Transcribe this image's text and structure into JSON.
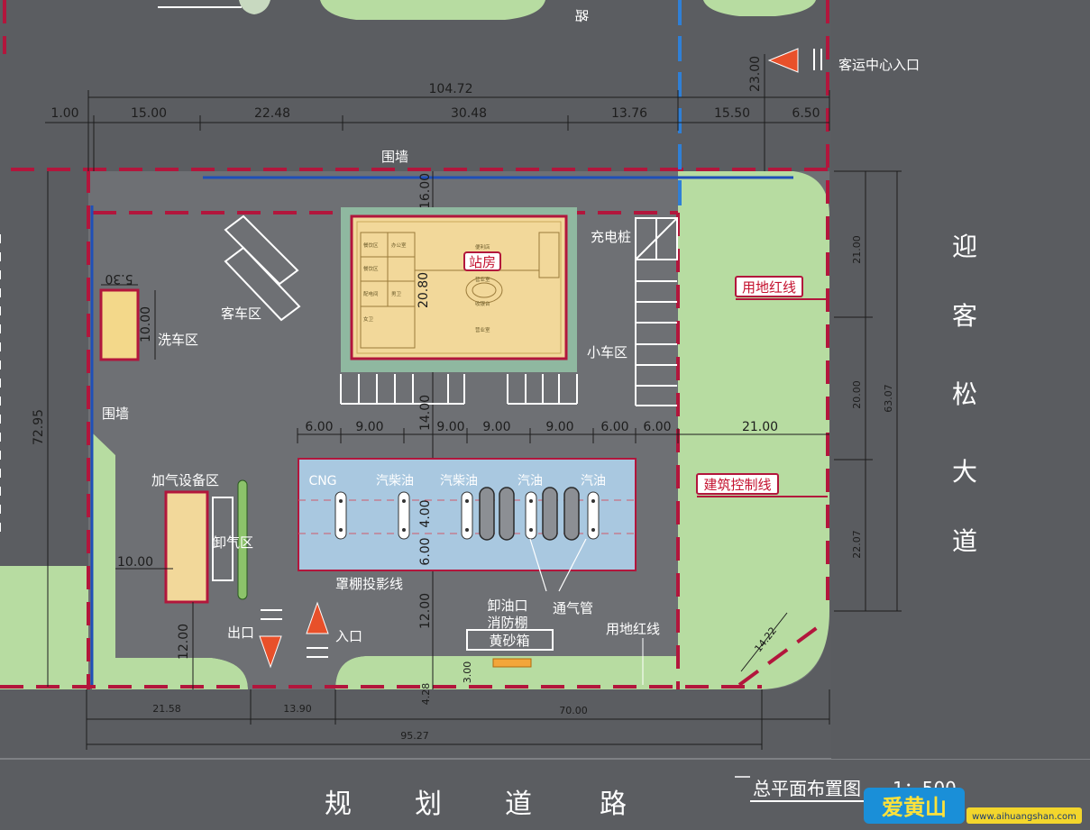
{
  "road_top": "路",
  "entrance_label": "客运中心入口",
  "overall_dim": "104.72",
  "top_dims": [
    "1.00",
    "15.00",
    "22.48",
    "30.48",
    "13.76",
    "15.50",
    "6.50"
  ],
  "dim_23": "23.00",
  "wall_label_top": "围墙",
  "wall_label_left": "围墙",
  "dim_16": "16.00",
  "dim_20_80": "20.80",
  "station_label": "站房",
  "room_labels": [
    "餐饮区",
    "办公室",
    "餐饮区",
    "便利店",
    "营业室",
    "收银台",
    "配电间",
    "男卫",
    "女卫",
    "营业室"
  ],
  "charging_label": "充电桩",
  "small_car_label": "小车区",
  "bus_label": "客车区",
  "wash_label": "洗车区",
  "dim_5_30": "5.30",
  "dim_10_wash": "10.00",
  "redline_tag": "用地红线",
  "control_tag": "建筑控制线",
  "redline_label": "用地红线",
  "avenue_chars": [
    "迎",
    "客",
    "松",
    "大",
    "道"
  ],
  "right_dims": [
    "21.00",
    "20.00",
    "22.07",
    "63.07"
  ],
  "left_dim_72": "72.95",
  "row_dims": [
    "6.00",
    "9.00",
    "9.00",
    "9.00",
    "9.00",
    "6.00",
    "6.00"
  ],
  "dim_14": "14.00",
  "dim_21_right": "21.00",
  "canopy_labels": [
    "CNG",
    "汽柴油",
    "汽柴油",
    "汽油",
    "汽油"
  ],
  "dim_4": "4.00",
  "dim_6": "6.00",
  "canopy_label": "罩棚投影线",
  "gas_area_label": "加气设备区",
  "unload_label": "卸气区",
  "dim_10_left": "10.00",
  "vent_label": "通气管",
  "oil_unload_label": "卸油口",
  "fire_shed_label": "消防棚",
  "sand_box_label": "黄砂箱",
  "dim_12_mid": "12.00",
  "dim_12_left": "12.00",
  "dim_3": "3.00",
  "dim_4_28": "4.28",
  "dim_14_22": "14.22",
  "exit_label": "出口",
  "entry_label": "入口",
  "bottom_dims": [
    "21.58",
    "13.90",
    "70.00",
    "95.27"
  ],
  "road_bottom_chars": [
    "规",
    "划",
    "道",
    "路"
  ],
  "plan_title": "总平面布置图",
  "plan_scale": "1：500",
  "watermark_brand": "爱黄山",
  "watermark_url": "www.aihuangshan.com",
  "colors": {
    "road": "#5b5d61",
    "site": "#707275",
    "green": "#b7dca1",
    "redline": "#b2163c",
    "blue": "#1f4fb8",
    "building": "#f2d89a",
    "canopy": "#a9c8e0",
    "wash": "#f3d88a"
  }
}
